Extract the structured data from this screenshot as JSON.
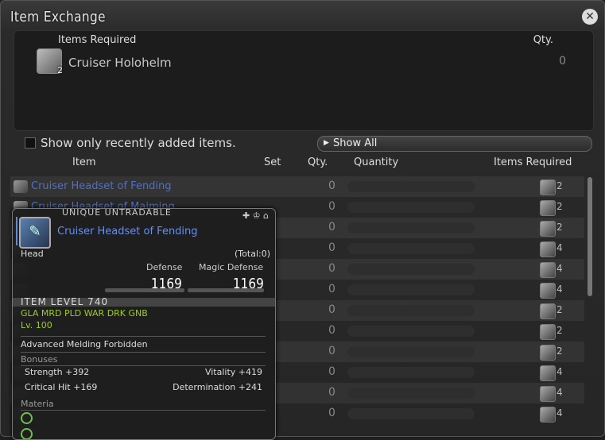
{
  "window": {
    "title": "Item Exchange",
    "close_icon": "close-icon"
  },
  "required": {
    "header_items": "Items Required",
    "header_qty": "Qty.",
    "item_name": "Cruiser Holohelm",
    "item_count": "2",
    "qty": "0"
  },
  "filter": {
    "checkbox_label": "Show only recently added items.",
    "show_all_label": "Show All"
  },
  "columns": {
    "item": "Item",
    "set": "Set",
    "qty": "Qty.",
    "quantity": "Quantity",
    "items_required": "Items Required"
  },
  "rows": [
    {
      "name": "Cruiser Headset of Fending",
      "qty": "0",
      "req_count": "2"
    },
    {
      "name": "Cruiser Headset of Maiming",
      "qty": "0",
      "req_count": "2"
    },
    {
      "name": "",
      "qty": "0",
      "req_count": "2"
    },
    {
      "name": "",
      "qty": "0",
      "req_count": "4"
    },
    {
      "name": "",
      "qty": "0",
      "req_count": "4"
    },
    {
      "name": "",
      "qty": "0",
      "req_count": "4"
    },
    {
      "name": "",
      "qty": "0",
      "req_count": "2"
    },
    {
      "name": "",
      "qty": "0",
      "req_count": "2"
    },
    {
      "name": "",
      "qty": "0",
      "req_count": "2"
    },
    {
      "name": "",
      "qty": "0",
      "req_count": "4"
    },
    {
      "name": "",
      "qty": "0",
      "req_count": "4"
    },
    {
      "name": "",
      "qty": "0",
      "req_count": "4"
    }
  ],
  "tooltip": {
    "tags": "UNIQUE   UNTRADABLE",
    "name": "Cruiser Headset of Fending",
    "slot": "Head",
    "total": "(Total:0)",
    "defense_label": "Defense",
    "defense_value": "1169",
    "magic_defense_label": "Magic Defense",
    "magic_defense_value": "1169",
    "item_level": "ITEM LEVEL 740",
    "jobs": "GLA MRD PLD WAR DRK GNB",
    "level": "Lv. 100",
    "melding": "Advanced Melding Forbidden",
    "bonuses_label": "Bonuses",
    "strength": "Strength +392",
    "vitality": "Vitality +419",
    "critical_hit": "Critical Hit +169",
    "determination": "Determination +241",
    "materia_label": "Materia"
  }
}
